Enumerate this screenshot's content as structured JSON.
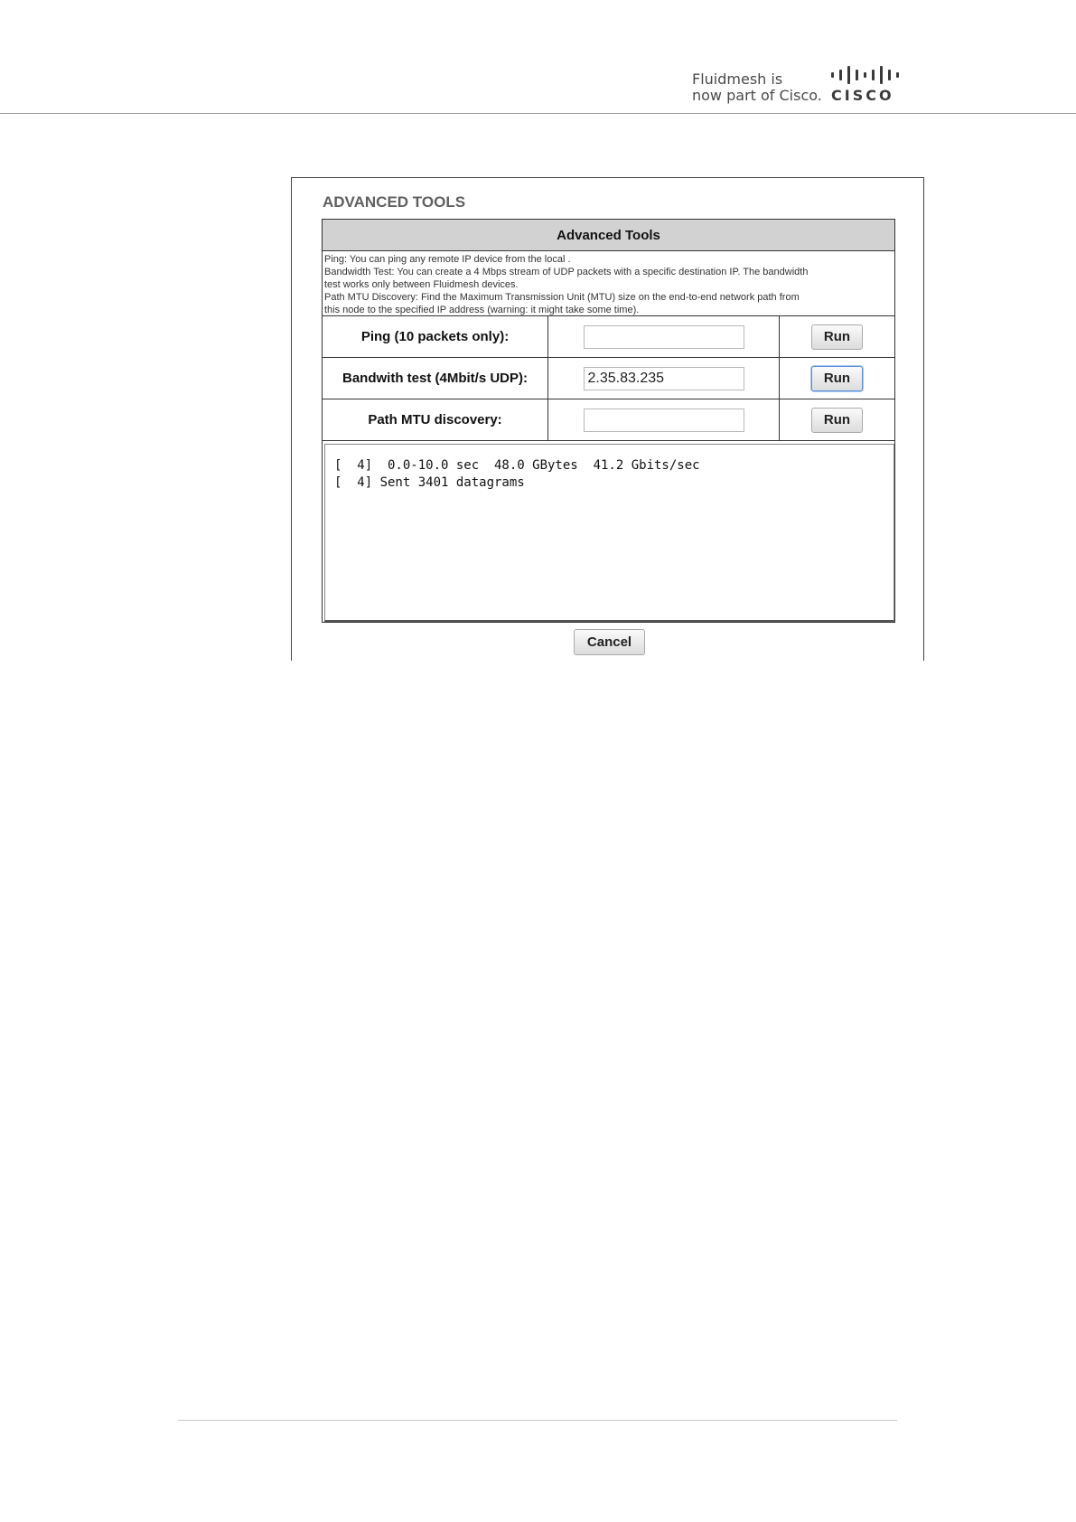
{
  "header": {
    "brand_line1": "Fluidmesh is",
    "brand_line2": "now part of Cisco.",
    "logo_word": "CISCO",
    "logo_icon": "cisco-bars-logo"
  },
  "section_title": "ADVANCED TOOLS",
  "panel": {
    "title": "Advanced Tools",
    "description": [
      "Ping: You can ping any remote IP device from the local .",
      "Bandwidth Test: You can create a 4 Mbps stream of UDP packets with a specific destination IP. The bandwidth",
      "test works only between Fluidmesh devices.",
      "Path MTU Discovery: Find the Maximum Transmission Unit (MTU) size on the end-to-end network path from",
      "this node to the specified IP address (warning: it might take some time)."
    ],
    "rows": [
      {
        "label": "Ping (10 packets only):",
        "value": "",
        "button": "Run"
      },
      {
        "label": "Bandwith test (4Mbit/s UDP):",
        "value": "2.35.83.235",
        "button": "Run"
      },
      {
        "label": "Path MTU discovery:",
        "value": "",
        "button": "Run"
      }
    ],
    "output": [
      "[  4]  0.0-10.0 sec  48.0 GBytes  41.2 Gbits/sec",
      "[  4] Sent 3401 datagrams"
    ],
    "cancel_label": "Cancel"
  },
  "colors": {
    "panel_header_bg": "#d2d2d2",
    "focus_ring": "#5b8fd6"
  }
}
